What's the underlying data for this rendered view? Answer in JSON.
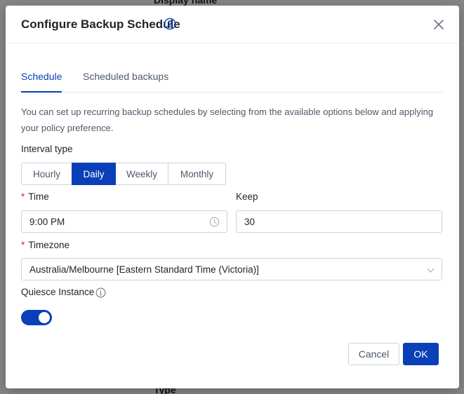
{
  "background": {
    "top_text": "Display name",
    "bottom_text": "Type"
  },
  "dialog": {
    "title": "Configure Backup Schedule",
    "help_icon": "question-circle-icon",
    "close_icon": "close-icon"
  },
  "tabs": [
    {
      "label": "Schedule",
      "active": true
    },
    {
      "label": "Scheduled backups",
      "active": false
    }
  ],
  "description": "You can set up recurring backup schedules by selecting from the available options below and applying your policy preference.",
  "interval": {
    "label": "Interval type",
    "options": [
      "Hourly",
      "Daily",
      "Weekly",
      "Monthly"
    ],
    "selected": "Daily"
  },
  "time": {
    "label": "Time",
    "required": "*",
    "value": "9:00 PM",
    "icon": "clock-icon"
  },
  "keep": {
    "label": "Keep",
    "value": "30"
  },
  "timezone": {
    "label": "Timezone",
    "required": "*",
    "value": "Australia/Melbourne [Eastern Standard Time (Victoria)]",
    "icon": "chevron-down-icon"
  },
  "quiesce": {
    "label": "Quiesce Instance",
    "info_icon": "info-circle-icon",
    "enabled": true
  },
  "footer": {
    "cancel_label": "Cancel",
    "ok_label": "OK"
  },
  "colors": {
    "primary": "#0a3fb8",
    "required": "#e02020"
  }
}
